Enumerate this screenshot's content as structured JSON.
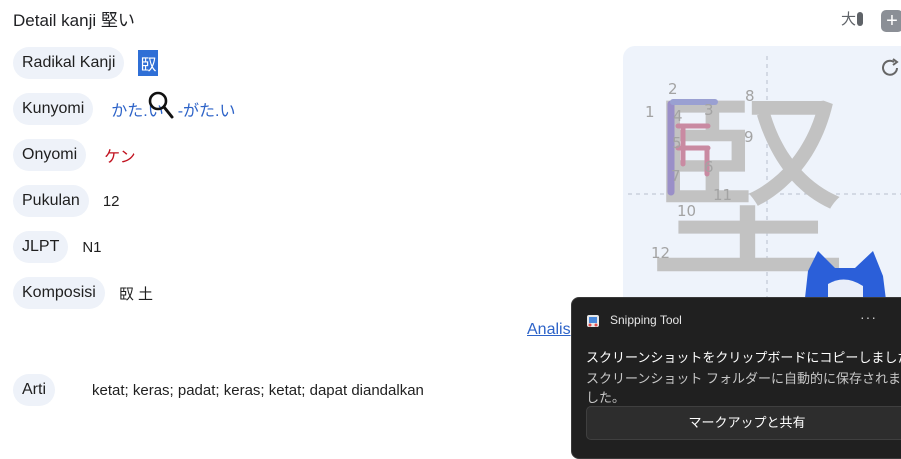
{
  "header": {
    "title": "Detail kanji 堅い",
    "font_size_icon": "大",
    "add_icon": "+"
  },
  "rows": {
    "radical": {
      "label": "Radikal Kanji",
      "value": "臤"
    },
    "kunyomi": {
      "label": "Kunyomi",
      "value1": "かた.い",
      "value2": "-がた.い"
    },
    "onyomi": {
      "label": "Onyomi",
      "value": "ケン"
    },
    "strokes": {
      "label": "Pukulan",
      "value": "12"
    },
    "jlpt": {
      "label": "JLPT",
      "value": "N1"
    },
    "composition": {
      "label": "Komposisi",
      "value": "臤 土"
    },
    "meaning": {
      "label": "Arti",
      "value": "ketat; keras; padat; keras; ketat; dapat diandalkan"
    }
  },
  "analysis_link": "Analis",
  "stroke_order": {
    "kanji": "堅",
    "numbers": [
      "1",
      "2",
      "3",
      "4",
      "5",
      "6",
      "7",
      "8",
      "9",
      "10",
      "11",
      "12"
    ]
  },
  "toast": {
    "app_name": "Snipping Tool",
    "more": "···",
    "message": "スクリーンショットをクリップボードにコピーしました",
    "sub_message": "スクリーンショット フォルダーに自動的に保存されました。",
    "button": "マークアップと共有"
  },
  "colors": {
    "accent_blue": "#2d63c8",
    "onyomi_red": "#c1121f",
    "pill_bg": "#eef2f9",
    "toast_bg": "#202020"
  }
}
